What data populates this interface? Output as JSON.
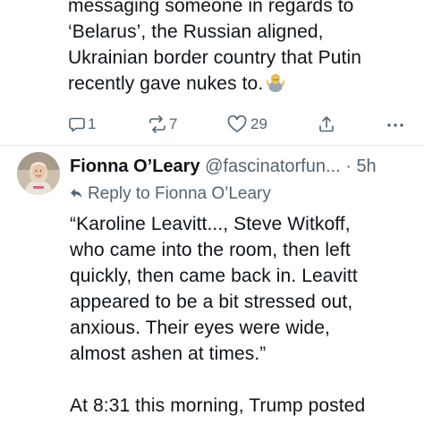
{
  "previous_tweet": {
    "lines": [
      "messaging someone in regards to",
      "‘Belarus’, the Russian aligned,",
      "Ukrainian border country that Putin",
      "recently gave nukes to."
    ],
    "emoji": "person-shrugging-emoji",
    "actions": {
      "reply_count": "1",
      "retweet_count": "7",
      "like_count": "29",
      "share_icon": "share-icon",
      "more_icon": "more-icon"
    }
  },
  "tweet": {
    "author_name": "Fionna O’Leary",
    "handle": "@fascinatorfun...",
    "separator": "·",
    "timestamp": "5h",
    "reply_to": "Reply to Fionna O’Leary",
    "body_lines": [
      "“Karoline Leavitt..., Steve Witkoff,",
      "who came into the room, then left",
      "quickly, then came back in. Leavitt",
      "appeared to be a bit stressed out,",
      "anxious. Their eyes were wide,",
      "almost ashen at times.”"
    ],
    "body_lines_2": [
      "At 8:31 this morning, Trump posted"
    ]
  },
  "colors": {
    "text": "#0f1419",
    "secondary": "#536471",
    "divider": "#e6e9ec"
  }
}
